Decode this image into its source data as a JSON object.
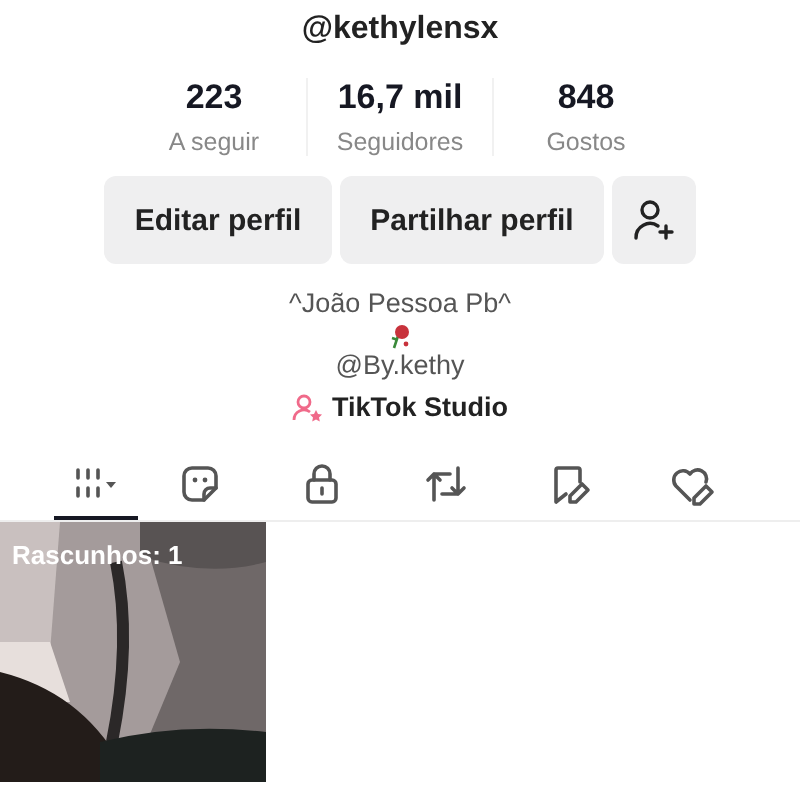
{
  "profile": {
    "username": "@kethylensx"
  },
  "stats": [
    {
      "value": "223",
      "label": "A seguir"
    },
    {
      "value": "16,7 mil",
      "label": "Seguidores"
    },
    {
      "value": "848",
      "label": "Gostos"
    }
  ],
  "buttons": [
    "Editar perfil",
    "Partilhar perfil"
  ],
  "bio": {
    "location": "^João Pessoa Pb^",
    "link": "@By.kethy",
    "studio": "TikTok Studio"
  },
  "tabs": [
    {
      "kind": "grid",
      "selected": true
    },
    {
      "kind": "sticker",
      "selected": false
    },
    {
      "kind": "lock",
      "selected": false
    },
    {
      "kind": "repost",
      "selected": false
    },
    {
      "kind": "bookmark",
      "selected": false
    },
    {
      "kind": "heart",
      "selected": false
    }
  ],
  "videos": [
    {
      "kind": "picture",
      "caption": "Rascunhos: 1"
    }
  ]
}
